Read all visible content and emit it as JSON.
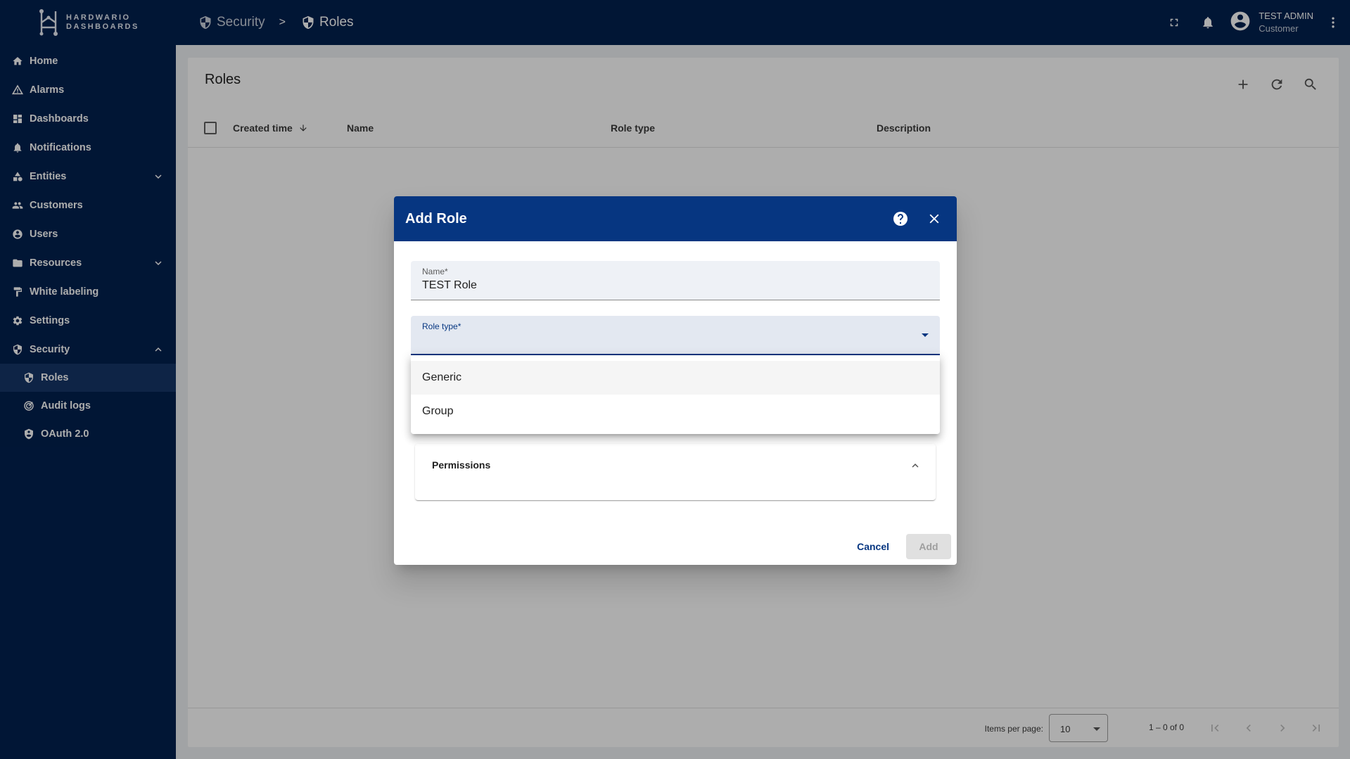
{
  "brand": {
    "line1": "HARDWARIO",
    "line2": "DASHBOARDS"
  },
  "sidebar": {
    "items": [
      {
        "label": "Home",
        "icon": "home-icon"
      },
      {
        "label": "Alarms",
        "icon": "warning-icon"
      },
      {
        "label": "Dashboards",
        "icon": "dashboard-icon"
      },
      {
        "label": "Notifications",
        "icon": "notification-icon"
      },
      {
        "label": "Entities",
        "icon": "entities-icon"
      },
      {
        "label": "Customers",
        "icon": "customers-icon"
      },
      {
        "label": "Users",
        "icon": "user-icon"
      },
      {
        "label": "Resources",
        "icon": "folder-icon"
      },
      {
        "label": "White labeling",
        "icon": "paint-roller-icon"
      },
      {
        "label": "Settings",
        "icon": "gear-icon"
      },
      {
        "label": "Security",
        "icon": "shield-icon"
      }
    ],
    "security_sub": [
      {
        "label": "Roles"
      },
      {
        "label": "Audit logs"
      },
      {
        "label": "OAuth 2.0"
      }
    ]
  },
  "breadcrumb": {
    "parent": "Security",
    "separator": ">",
    "current": "Roles"
  },
  "user": {
    "name": "TEST ADMIN",
    "role": "Customer"
  },
  "card": {
    "title": "Roles",
    "columns": {
      "created": "Created time",
      "name": "Name",
      "role_type": "Role type",
      "description": "Description"
    },
    "paginator": {
      "items_per_page_label": "Items per page:",
      "page_size": "10",
      "range": "1 – 0 of 0"
    }
  },
  "dialog": {
    "title": "Add Role",
    "name_label": "Name*",
    "name_value": "TEST Role",
    "role_type_label": "Role type*",
    "role_type_options": [
      "Generic",
      "Group"
    ],
    "permissions_label": "Permissions",
    "cancel_label": "Cancel",
    "add_label": "Add"
  },
  "colors": {
    "sidebar_bg": "#02214f",
    "dialog_header": "#063681",
    "active_item": "#163668"
  }
}
